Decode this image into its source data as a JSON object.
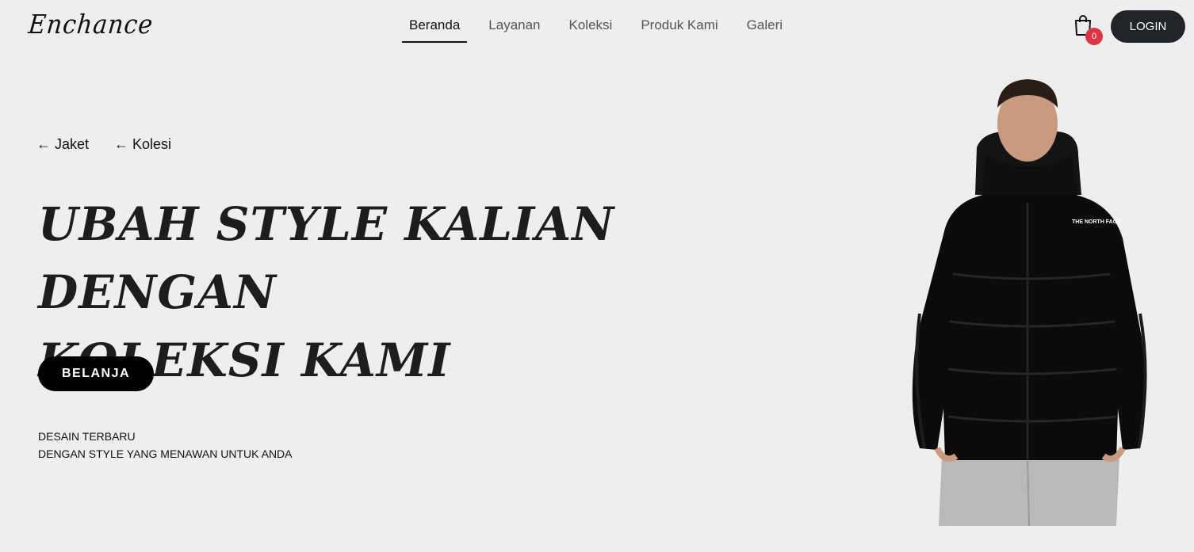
{
  "brand": "Enchance",
  "nav": {
    "links": [
      {
        "label": "Beranda",
        "active": true
      },
      {
        "label": "Layanan",
        "active": false
      },
      {
        "label": "Koleksi",
        "active": false
      },
      {
        "label": "Produk Kami",
        "active": false
      },
      {
        "label": "Galeri",
        "active": false
      }
    ],
    "cart_count": "0",
    "login_label": "LOGIN"
  },
  "hero": {
    "crumbs": [
      "← Jaket",
      "← Kolesi"
    ],
    "headline_line1": "Ubah Style kalian dengan",
    "headline_line2": "koleksi kami",
    "shop_label": "BELANJA",
    "tagline_line1": "DESAIN TERBARU",
    "tagline_line2": "DENGAN STYLE YANG MENAWAN UNTUK ANDA",
    "image_logo_text": "THE NORTH FACE"
  },
  "colors": {
    "background": "#eeeeee",
    "primary_dark": "#212529",
    "badge": "#dc3545",
    "jacket": "#0b0b0b",
    "pants": "#b9b9b9"
  },
  "icons": [
    "shopping-bag-icon"
  ]
}
